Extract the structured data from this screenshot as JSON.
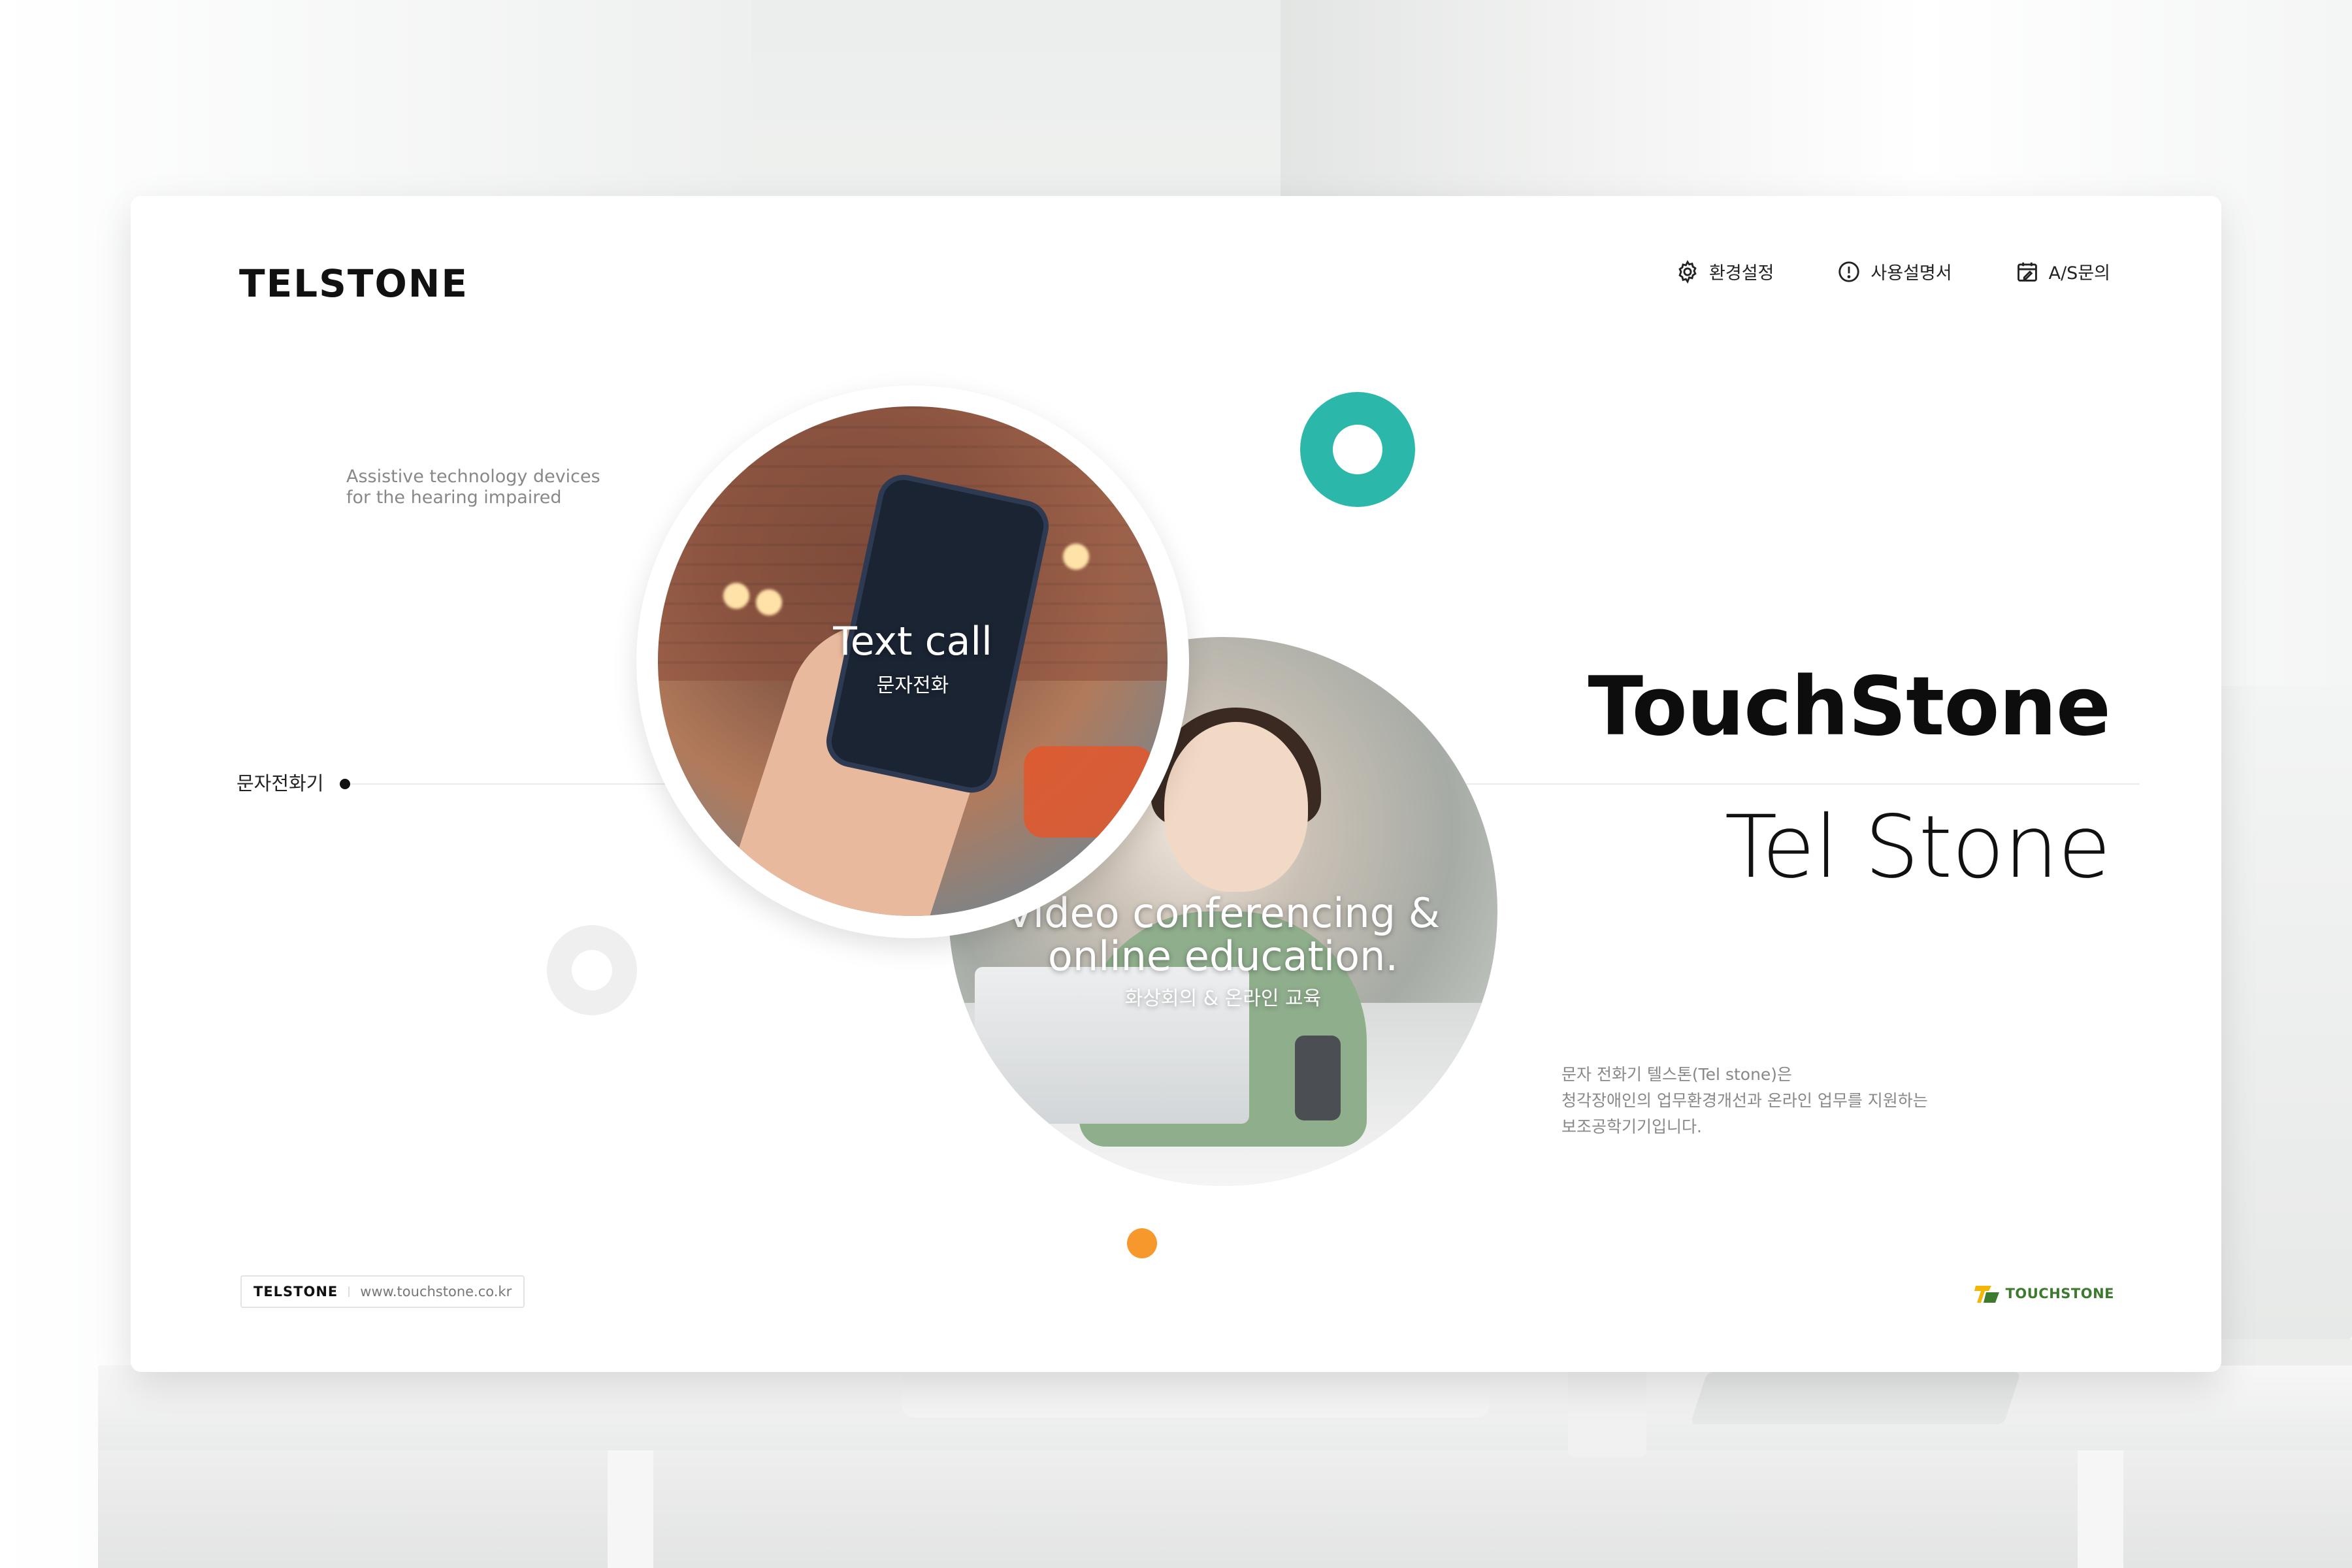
{
  "brand": {
    "logo_text": "TELSTONE",
    "footer_logo_text": "TELSTONE",
    "url": "www.touchstone.co.kr",
    "partner_text": "TOUCHSTONE",
    "partner_colors": [
      "#f2b705",
      "#3c7b2e"
    ]
  },
  "nav": {
    "items": [
      {
        "label": "환경설정",
        "icon": "gear-icon"
      },
      {
        "label": "사용설명서",
        "icon": "info-icon"
      },
      {
        "label": "A/S문의",
        "icon": "calendar-edit-icon"
      }
    ]
  },
  "hero": {
    "tagline_line1": "Assistive technology devices",
    "tagline_line2": "for the hearing impaired",
    "side_label": "문자전화기",
    "headline": "TouchStone",
    "subheadline": "Tel Stone"
  },
  "features": {
    "text_call": {
      "title": "Text call",
      "subtitle": "문자전화"
    },
    "video": {
      "title_line1": "Video conferencing &",
      "title_line2": "online education.",
      "subtitle": "화상회의 & 온라인 교육"
    }
  },
  "description": {
    "line1": "문자 전화기 텔스톤(Tel stone)은",
    "line2": "청각장애인의 업무환경개선과 온라인 업무를 지원하는",
    "line3": "보조공학기기입니다."
  },
  "colors": {
    "accent_teal": "#2bb7aa",
    "accent_orange": "#f7982c",
    "ring_grey": "#efefef"
  }
}
